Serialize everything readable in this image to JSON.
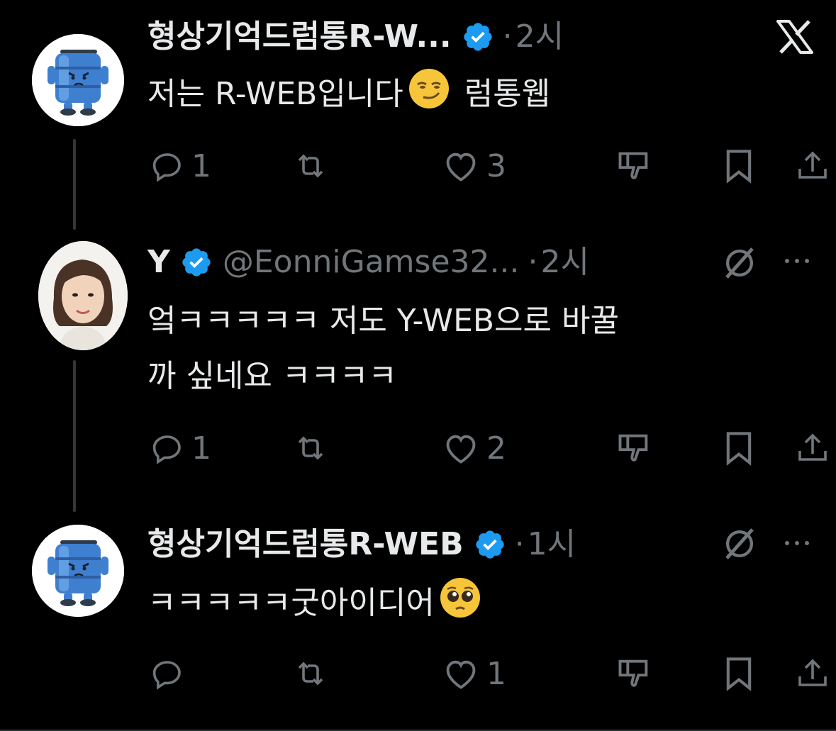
{
  "close_label": "X",
  "tweets": [
    {
      "name": "형상기억드럼통R-W...",
      "handle": "",
      "time": "2시",
      "text_before_emoji": "저는 R-WEB입니다",
      "emoji": "smirking-face",
      "text_after_emoji": " 럼통웹",
      "avatar": "drum-character",
      "actions": {
        "reply": "1",
        "retweet": "",
        "like": "3"
      },
      "show_grok": false
    },
    {
      "name": "Y",
      "handle": "@EonniGamse32...",
      "time": "2시",
      "text_line1": "엌ㅋㅋㅋㅋㅋ 저도 Y-WEB으로 바꿀",
      "text_line2": "까 싶네요 ㅋㅋㅋㅋ",
      "avatar": "woman-portrait",
      "actions": {
        "reply": "1",
        "retweet": "",
        "like": "2"
      },
      "show_grok": true
    },
    {
      "name": "형상기억드럼통R-WEB",
      "handle": "",
      "time": "1시",
      "text_before_emoji": "ㅋㅋㅋㅋㅋ굿아이디어",
      "emoji": "pleading-face",
      "avatar": "drum-character",
      "actions": {
        "reply": "",
        "retweet": "",
        "like": "1"
      },
      "show_grok": true
    }
  ],
  "colors": {
    "background": "#000000",
    "text": "#e7e9ea",
    "muted": "#71767b",
    "verified": "#1d9bf0"
  }
}
